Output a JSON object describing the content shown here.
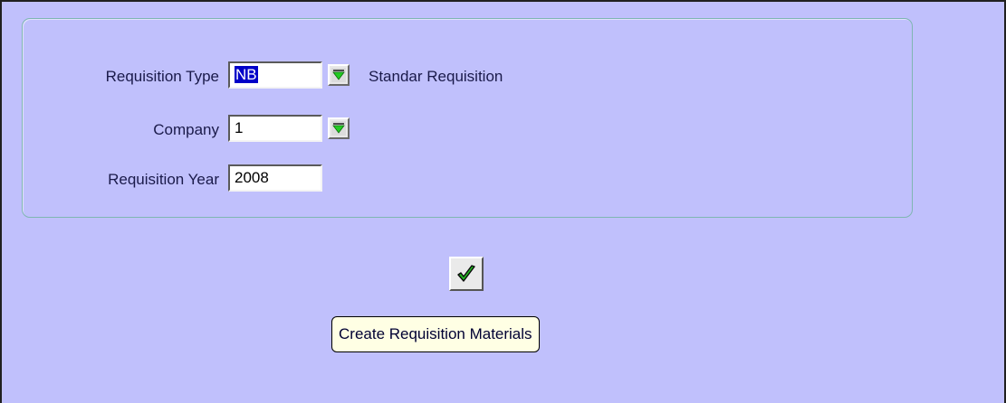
{
  "form": {
    "requisition_type": {
      "label": "Requisition Type",
      "value": "NB",
      "description": "Standar Requisition",
      "lov_icon": "dropdown-list-icon"
    },
    "company": {
      "label": "Company",
      "value": "1",
      "lov_icon": "dropdown-list-icon"
    },
    "requisition_year": {
      "label": "Requisition Year",
      "value": "2008"
    }
  },
  "actions": {
    "confirm_icon": "checkmark-icon",
    "tooltip": "Create Requisition Materials"
  },
  "colors": {
    "background": "#c0c0fc",
    "panel_border": "#7fb6b2",
    "selection": "#0000c8",
    "lov_arrow": "#22cc22",
    "check": "#22b422",
    "tooltip_bg": "#ffffe4"
  }
}
